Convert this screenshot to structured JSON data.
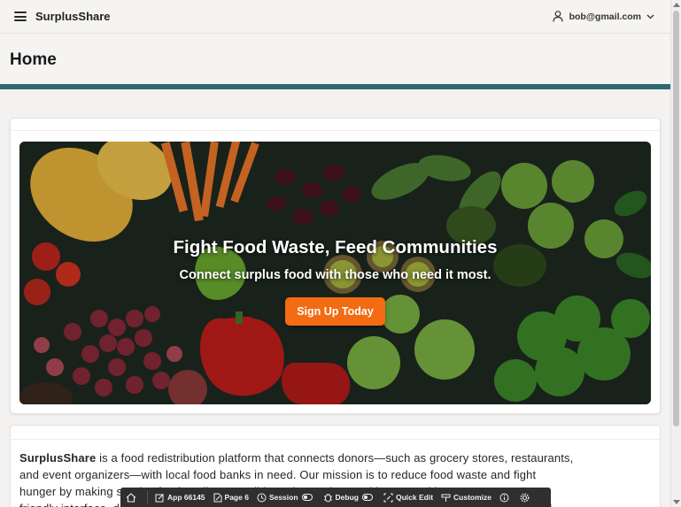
{
  "header": {
    "app_title": "SurplusShare",
    "user_name": "bob@gmail.com",
    "menu_icon": "hamburger-icon",
    "user_icon": "user-icon"
  },
  "page": {
    "title": "Home"
  },
  "hero": {
    "headline": "Fight Food Waste, Feed Communities",
    "subheadline": "Connect surplus food with those who need it most.",
    "cta_label": "Sign Up Today",
    "cta_color": "#f36b12"
  },
  "about": {
    "brand": "SurplusShare",
    "text_lines": [
      " is a food redistribution platform that connects donors—such as grocery stores, restaurants,",
      "and event organizers—with local food banks in need. Our mission is to reduce food waste and fight",
      "hunger by making surplus food easily accessible to those who need it most. With a user-",
      "friendly interface, donors can quickly post available food items and food banks can browse, claim, and"
    ]
  },
  "dev_toolbar": {
    "items": [
      {
        "label": "",
        "icon": "home-icon"
      },
      {
        "label": "App 66145",
        "icon": "edit-icon"
      },
      {
        "label": "Page 6",
        "icon": "page-edit-icon"
      },
      {
        "label": "Session",
        "icon": "session-icon"
      },
      {
        "label": "Debug",
        "icon": "debug-icon"
      },
      {
        "label": "Quick Edit",
        "icon": "quick-edit-icon"
      },
      {
        "label": "Customize",
        "icon": "customize-icon"
      },
      {
        "label": "",
        "icon": "info-icon"
      },
      {
        "label": "",
        "icon": "settings-icon"
      }
    ]
  },
  "colors": {
    "accent": "#f36b12",
    "devbar": "#2f2f2f",
    "background": "#f3f2f0"
  }
}
